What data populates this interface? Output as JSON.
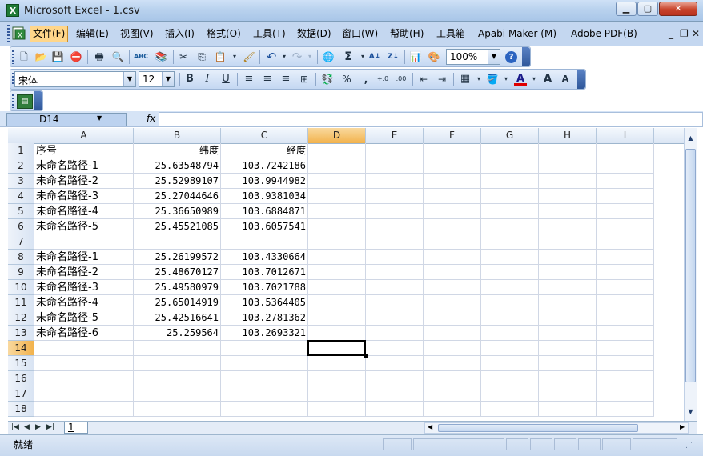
{
  "window": {
    "title": "Microsoft Excel - 1.csv",
    "app_icon": "X",
    "min_glyph": "▁",
    "max_glyph": "▢",
    "close_glyph": "✕"
  },
  "menu": {
    "items": [
      "文件(F)",
      "编辑(E)",
      "视图(V)",
      "插入(I)",
      "格式(O)",
      "工具(T)",
      "数据(D)",
      "窗口(W)",
      "帮助(H)",
      "工具箱",
      "Apabi Maker (M)",
      "Adobe PDF(B)"
    ],
    "active_index": 0,
    "doc_controls": [
      "_",
      "❐",
      "✕"
    ]
  },
  "toolbar": {
    "zoom": "100%",
    "sigma": "Σ",
    "percent": "%",
    "comma": ",",
    "inc_decimal": "+.0",
    "dec_decimal": ".00"
  },
  "format_toolbar": {
    "font": "宋体",
    "size": "12",
    "bold": "B",
    "italic": "I",
    "underline": "U",
    "font_color_label": "A",
    "grow": "A",
    "shrink": "A"
  },
  "formula_bar": {
    "name_box": "D14",
    "fx": "fx",
    "content": ""
  },
  "grid": {
    "columns": [
      "A",
      "B",
      "C",
      "D",
      "E",
      "F",
      "G",
      "H",
      "I"
    ],
    "active_column": "D",
    "active_row": 14,
    "rows": [
      {
        "num": "1",
        "cells": [
          "序号",
          "纬度",
          "经度"
        ]
      },
      {
        "num": "2",
        "cells": [
          "未命名路径-1",
          "25.63548794",
          "103.7242186"
        ]
      },
      {
        "num": "3",
        "cells": [
          "未命名路径-2",
          "25.52989107",
          "103.9944982"
        ]
      },
      {
        "num": "4",
        "cells": [
          "未命名路径-3",
          "25.27044646",
          "103.9381034"
        ]
      },
      {
        "num": "5",
        "cells": [
          "未命名路径-4",
          "25.36650989",
          "103.6884871"
        ]
      },
      {
        "num": "6",
        "cells": [
          "未命名路径-5",
          "25.45521085",
          "103.6057541"
        ]
      },
      {
        "num": "7",
        "cells": [
          "",
          "",
          ""
        ]
      },
      {
        "num": "8",
        "cells": [
          "未命名路径-1",
          "25.26199572",
          "103.4330664"
        ]
      },
      {
        "num": "9",
        "cells": [
          "未命名路径-2",
          "25.48670127",
          "103.7012671"
        ]
      },
      {
        "num": "10",
        "cells": [
          "未命名路径-3",
          "25.49580979",
          "103.7021788"
        ]
      },
      {
        "num": "11",
        "cells": [
          "未命名路径-4",
          "25.65014919",
          "103.5364405"
        ]
      },
      {
        "num": "12",
        "cells": [
          "未命名路径-5",
          "25.42516641",
          "103.2781362"
        ]
      },
      {
        "num": "13",
        "cells": [
          "未命名路径-6",
          "25.259564",
          "103.2693321"
        ]
      },
      {
        "num": "14",
        "cells": [
          "",
          "",
          ""
        ]
      },
      {
        "num": "15",
        "cells": [
          "",
          "",
          ""
        ]
      },
      {
        "num": "16",
        "cells": [
          "",
          "",
          ""
        ]
      },
      {
        "num": "17",
        "cells": [
          "",
          "",
          ""
        ]
      },
      {
        "num": "18",
        "cells": [
          "",
          "",
          ""
        ]
      }
    ]
  },
  "sheet_tabs": {
    "nav": [
      "|◀",
      "◀",
      "▶",
      "▶|"
    ],
    "tabs": [
      "1"
    ]
  },
  "status": {
    "text": "就绪"
  },
  "icons": {
    "new": "🗋",
    "open": "📂",
    "save": "💾",
    "print": "🖶",
    "preview": "🔍",
    "spell": "ABC",
    "cut": "✂",
    "copy": "⎘",
    "paste": "📋",
    "undo": "↶",
    "redo": "↷",
    "hyperlink": "🌐",
    "sort_asc": "A↓",
    "sort_desc": "Z↓",
    "chart": "📊",
    "help": "?"
  }
}
